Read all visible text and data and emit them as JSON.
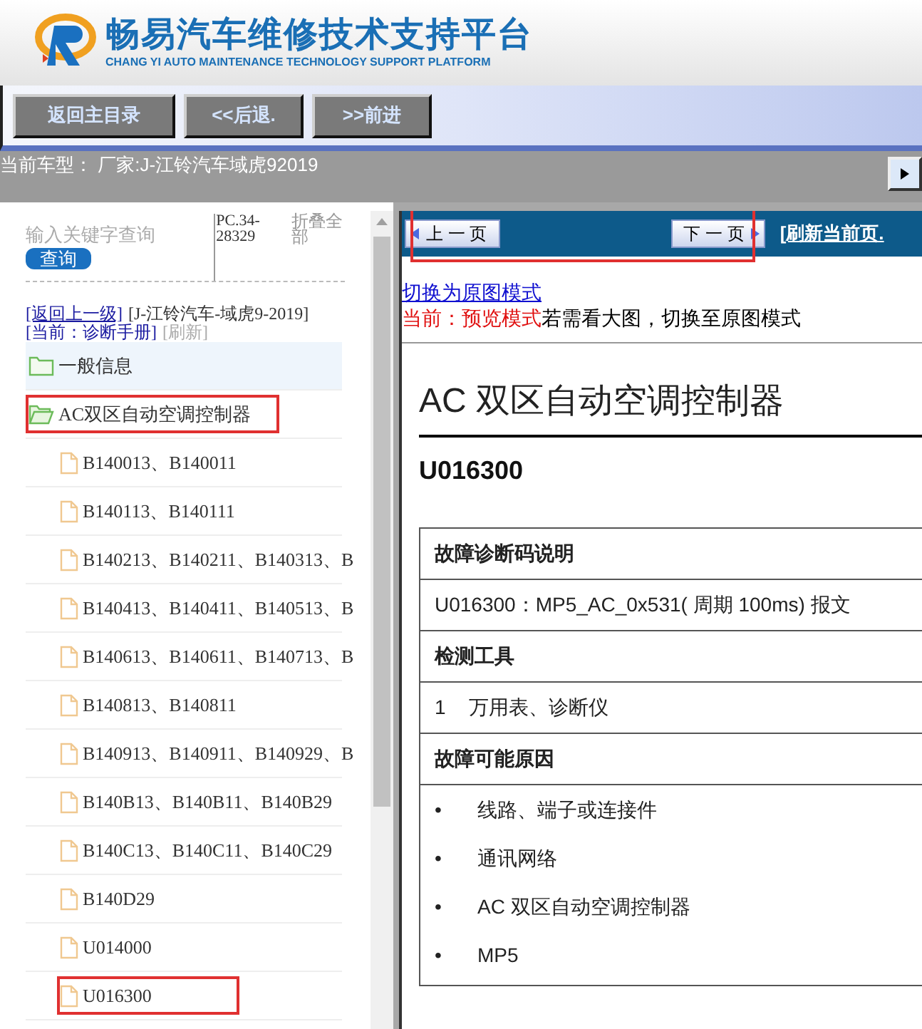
{
  "header": {
    "title": "畅易汽车维修技术支持平台",
    "subtitle": "CHANG YI AUTO MAINTENANCE TECHNOLOGY SUPPORT PLATFORM"
  },
  "toolbar": {
    "buttons": [
      "返回主目录",
      "<<后退.",
      ">>前进"
    ]
  },
  "vehicle_bar": {
    "text": "当前车型： 厂家:J-江铃汽车域虎92019"
  },
  "sidebar": {
    "search": {
      "placeholder": "输入关键字查询",
      "button": "查询"
    },
    "code": "PC.34-28329",
    "collapse_all": "折叠全部",
    "breadcrumb": {
      "back": "[返回上一级]",
      "vehicle": "[J-江铃汽车-域虎9-2019]",
      "current": "[当前：诊断手册]",
      "refresh": "[刷新]"
    },
    "tree": [
      {
        "kind": "folder",
        "label": "一般信息",
        "selected": true,
        "expanded": false,
        "highlighted": false
      },
      {
        "kind": "folder",
        "label": "AC双区自动空调控制器",
        "selected": false,
        "expanded": true,
        "highlighted": true,
        "children": [
          {
            "kind": "file",
            "label": "B140013、B140011",
            "selected": false,
            "highlighted": false
          },
          {
            "kind": "file",
            "label": "B140113、B140111",
            "selected": false,
            "highlighted": false
          },
          {
            "kind": "file",
            "label": "B140213、B140211、B140313、B",
            "selected": false,
            "highlighted": false
          },
          {
            "kind": "file",
            "label": "B140413、B140411、B140513、B",
            "selected": false,
            "highlighted": false
          },
          {
            "kind": "file",
            "label": "B140613、B140611、B140713、B",
            "selected": false,
            "highlighted": false
          },
          {
            "kind": "file",
            "label": "B140813、B140811",
            "selected": false,
            "highlighted": false
          },
          {
            "kind": "file",
            "label": "B140913、B140911、B140929、B",
            "selected": false,
            "highlighted": false
          },
          {
            "kind": "file",
            "label": "B140B13、B140B11、B140B29",
            "selected": false,
            "highlighted": false
          },
          {
            "kind": "file",
            "label": "B140C13、B140C11、B140C29",
            "selected": false,
            "highlighted": false
          },
          {
            "kind": "file",
            "label": "B140D29",
            "selected": false,
            "highlighted": false
          },
          {
            "kind": "file",
            "label": "U014000",
            "selected": false,
            "highlighted": false
          },
          {
            "kind": "file",
            "label": "U016300",
            "selected": false,
            "highlighted": true
          }
        ]
      }
    ]
  },
  "viewer": {
    "pager": {
      "prev": "上 一 页",
      "next": "下 一 页",
      "refresh": "[刷新当前页.",
      "highlighted": true
    },
    "mode_link": "切换为原图模式",
    "mode_status": "当前：预览模式",
    "mode_hint": "若需看大图，切换至原图模式",
    "document": {
      "title": "AC 双区自动空调控制器",
      "code": "U016300",
      "table": [
        {
          "kind": "heading",
          "text": "故障诊断码说明"
        },
        {
          "kind": "text",
          "text": "U016300：MP5_AC_0x531( 周期 100ms) 报文"
        },
        {
          "kind": "heading",
          "text": "检测工具"
        },
        {
          "kind": "numbered",
          "number": "1",
          "text": "万用表、诊断仪"
        },
        {
          "kind": "heading",
          "text": "故障可能原因"
        },
        {
          "kind": "bullets",
          "items": [
            {
              "marker": "•",
              "text": "线路、端子或连接件"
            },
            {
              "marker": "•",
              "text": "通讯网络"
            },
            {
              "marker": "•",
              "text": "AC 双区自动空调控制器"
            },
            {
              "marker": "•",
              "text": "MP5"
            }
          ]
        }
      ]
    }
  }
}
